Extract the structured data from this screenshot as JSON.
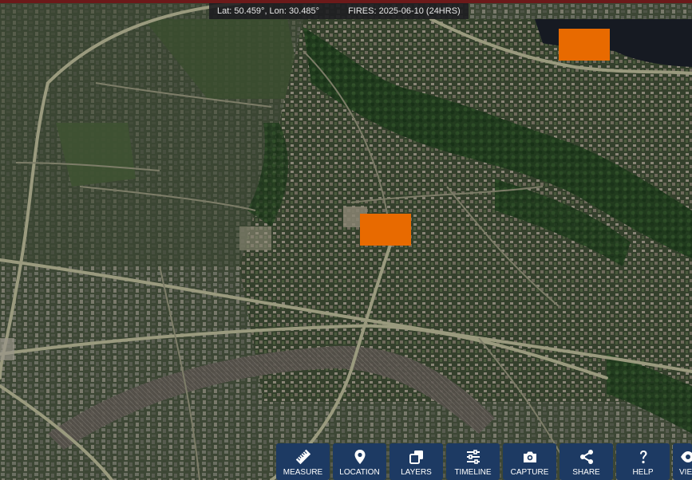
{
  "status": {
    "coords": "Lat: 50.459°, Lon: 30.485°",
    "fires": "FIRES: 2025-06-10 (24HRS)"
  },
  "toolbar": {
    "items": [
      {
        "label": "MEASURE",
        "icon": "ruler-icon"
      },
      {
        "label": "LOCATION",
        "icon": "location-pin-icon"
      },
      {
        "label": "LAYERS",
        "icon": "layers-icon"
      },
      {
        "label": "TIMELINE",
        "icon": "sliders-icon"
      },
      {
        "label": "CAPTURE",
        "icon": "camera-icon"
      },
      {
        "label": "SHARE",
        "icon": "share-icon"
      },
      {
        "label": "HELP",
        "icon": "question-icon"
      },
      {
        "label": "VIEW",
        "icon": "view-icon"
      }
    ]
  },
  "colors": {
    "fire_marker": "#e86a00",
    "toolbar_button": "#1d3a63",
    "status_bar": "#1c1c20"
  }
}
